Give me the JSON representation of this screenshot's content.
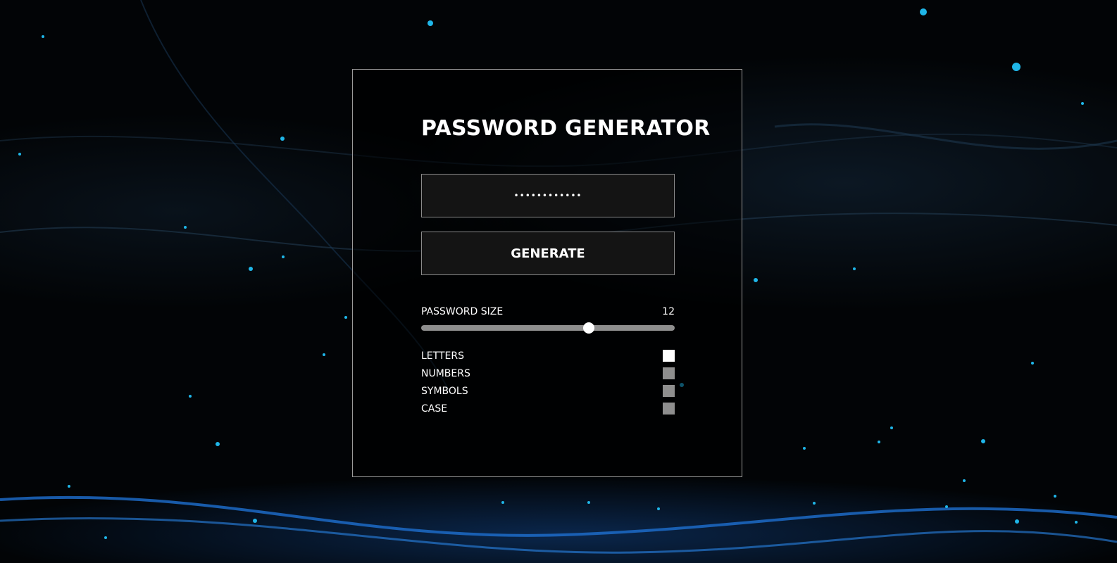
{
  "app": {
    "title": "PASSWORD GENERATOR"
  },
  "password_field": {
    "value": "••••••••••••"
  },
  "generate_button": {
    "label": "GENERATE"
  },
  "password_size": {
    "label": "PASSWORD SIZE",
    "value": "12",
    "slider_fraction": 0.66
  },
  "options": [
    {
      "label": "LETTERS",
      "checked": true
    },
    {
      "label": "NUMBERS",
      "checked": false
    },
    {
      "label": "SYMBOLS",
      "checked": false
    },
    {
      "label": "CASE",
      "checked": false
    }
  ],
  "colors": {
    "background": "#020406",
    "accent_particles": "#1fb6e8",
    "panel_border": "#9a9a9a",
    "control_fill": "#141414",
    "checkbox_unchecked": "#8e8e8e",
    "checkbox_checked": "#ffffff"
  }
}
